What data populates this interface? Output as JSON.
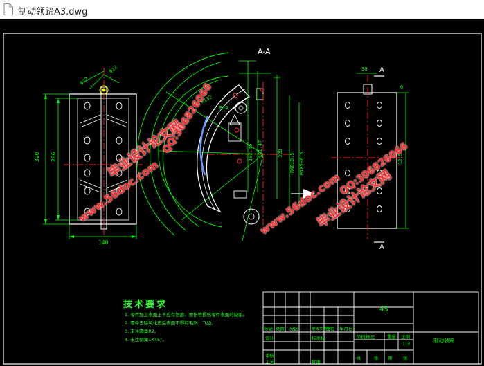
{
  "window": {
    "title": "制动领蹄A3.dwg"
  },
  "drawing": {
    "colors": {
      "background": "#000000",
      "outline": "#ffffff",
      "dimension": "#00ff00",
      "centerline": "#ff2020",
      "hatch": "#ffff00",
      "watermark": "#ff2a2a"
    },
    "section_label": "A-A",
    "view_letter": "A",
    "dimensions": {
      "left_height_outer": "320",
      "left_height_inner": "286",
      "left_width": "140",
      "angle_label": "R",
      "radius_a": "R132",
      "radius_b": "R14",
      "mid_a": "121.47",
      "mid_b": "102.45",
      "right_a": "R40±0.5",
      "right_b": "R105±0.5",
      "right_c": "6",
      "right_d": "12.5",
      "right_top": "30",
      "section_height": "320"
    },
    "watermarks": {
      "site": "www.56doc.com",
      "qq": "QQ:306826066",
      "cn": "毕业设计论文网"
    },
    "tech_requirements": {
      "heading": "技术要求",
      "items": [
        "1. 零件加工表面上不应有划痕、擦伤等损伤零件表面的缺陷。",
        "2. 零件去除氧化皮后表面不得有毛刺、飞边。",
        "3. 未注圆角R2。",
        "4. 未注倒角1X45°。"
      ]
    },
    "title_block": {
      "material": "45",
      "part_name": "制动领蹄",
      "scale": "1:3",
      "row_labels": [
        "标记",
        "处数",
        "分区",
        "更改文件号",
        "签名",
        "年月日"
      ],
      "stage_label": "阶段标记",
      "weight_label": "重量",
      "scale_label": "比例",
      "design_label": "设计",
      "standard_label": "标准化",
      "review_label": "审核",
      "process_label": "工艺",
      "approve_label": "批准",
      "sheets": [
        "共",
        "张",
        "第",
        "张"
      ]
    }
  }
}
